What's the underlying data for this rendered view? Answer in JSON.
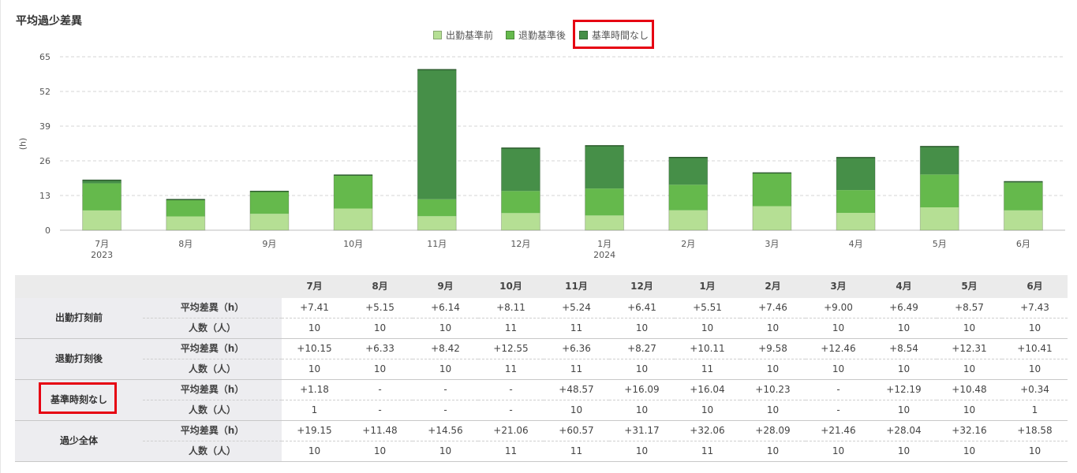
{
  "title": "平均過少差異",
  "legend": [
    {
      "label": "出勤基準前",
      "color": "#b5df94"
    },
    {
      "label": "退勤基準後",
      "color": "#65b94c"
    },
    {
      "label": "基準時間なし",
      "color": "#468f48"
    }
  ],
  "chart_data": {
    "type": "bar",
    "stacked": true,
    "categories": [
      "7月",
      "8月",
      "9月",
      "10月",
      "11月",
      "12月",
      "1月",
      "2月",
      "3月",
      "4月",
      "5月",
      "6月"
    ],
    "category_years": [
      "2023",
      "",
      "",
      "",
      "",
      "",
      "2024",
      "",
      "",
      "",
      "",
      ""
    ],
    "series": [
      {
        "name": "出勤基準前",
        "color": "#b5df94",
        "values": [
          7.41,
          5.15,
          6.14,
          8.11,
          5.24,
          6.41,
          5.51,
          7.46,
          9.0,
          6.49,
          8.57,
          7.43
        ]
      },
      {
        "name": "退勤基準後",
        "color": "#65b94c",
        "values": [
          10.15,
          6.33,
          8.42,
          12.55,
          6.36,
          8.27,
          10.11,
          9.58,
          12.46,
          8.54,
          12.31,
          10.41
        ]
      },
      {
        "name": "基準時間なし",
        "color": "#468f48",
        "values": [
          1.18,
          0,
          0,
          0,
          48.57,
          16.09,
          16.04,
          10.23,
          0,
          12.19,
          10.48,
          0.34
        ]
      }
    ],
    "ylabel": "(h)",
    "yticks": [
      0,
      13,
      26,
      39,
      52,
      65
    ],
    "ylim": [
      0,
      65
    ],
    "grid": true,
    "legend_position": "top-center"
  },
  "table": {
    "months": [
      "7月",
      "8月",
      "9月",
      "10月",
      "11月",
      "12月",
      "1月",
      "2月",
      "3月",
      "4月",
      "5月",
      "6月"
    ],
    "avg_label": "平均差異（h）",
    "count_label": "人数（人）",
    "groups": [
      {
        "name": "出勤打刻前",
        "avg": [
          "+7.41",
          "+5.15",
          "+6.14",
          "+8.11",
          "+5.24",
          "+6.41",
          "+5.51",
          "+7.46",
          "+9.00",
          "+6.49",
          "+8.57",
          "+7.43"
        ],
        "count": [
          "10",
          "10",
          "10",
          "11",
          "11",
          "10",
          "10",
          "10",
          "10",
          "10",
          "10",
          "10"
        ]
      },
      {
        "name": "退勤打刻後",
        "avg": [
          "+10.15",
          "+6.33",
          "+8.42",
          "+12.55",
          "+6.36",
          "+8.27",
          "+10.11",
          "+9.58",
          "+12.46",
          "+8.54",
          "+12.31",
          "+10.41"
        ],
        "count": [
          "10",
          "10",
          "10",
          "11",
          "11",
          "10",
          "11",
          "10",
          "10",
          "10",
          "10",
          "10"
        ]
      },
      {
        "name": "基準時刻なし",
        "avg": [
          "+1.18",
          "-",
          "-",
          "-",
          "+48.57",
          "+16.09",
          "+16.04",
          "+10.23",
          "-",
          "+12.19",
          "+10.48",
          "+0.34"
        ],
        "count": [
          "1",
          "-",
          "-",
          "-",
          "10",
          "10",
          "10",
          "10",
          "-",
          "10",
          "10",
          "1"
        ]
      },
      {
        "name": "過少全体",
        "avg": [
          "+19.15",
          "+11.48",
          "+14.56",
          "+21.06",
          "+60.57",
          "+31.17",
          "+32.06",
          "+28.09",
          "+21.46",
          "+28.04",
          "+32.16",
          "+18.58"
        ],
        "count": [
          "10",
          "10",
          "10",
          "11",
          "11",
          "10",
          "11",
          "10",
          "10",
          "10",
          "10",
          "10"
        ]
      }
    ]
  },
  "highlight_color": "#e60012"
}
